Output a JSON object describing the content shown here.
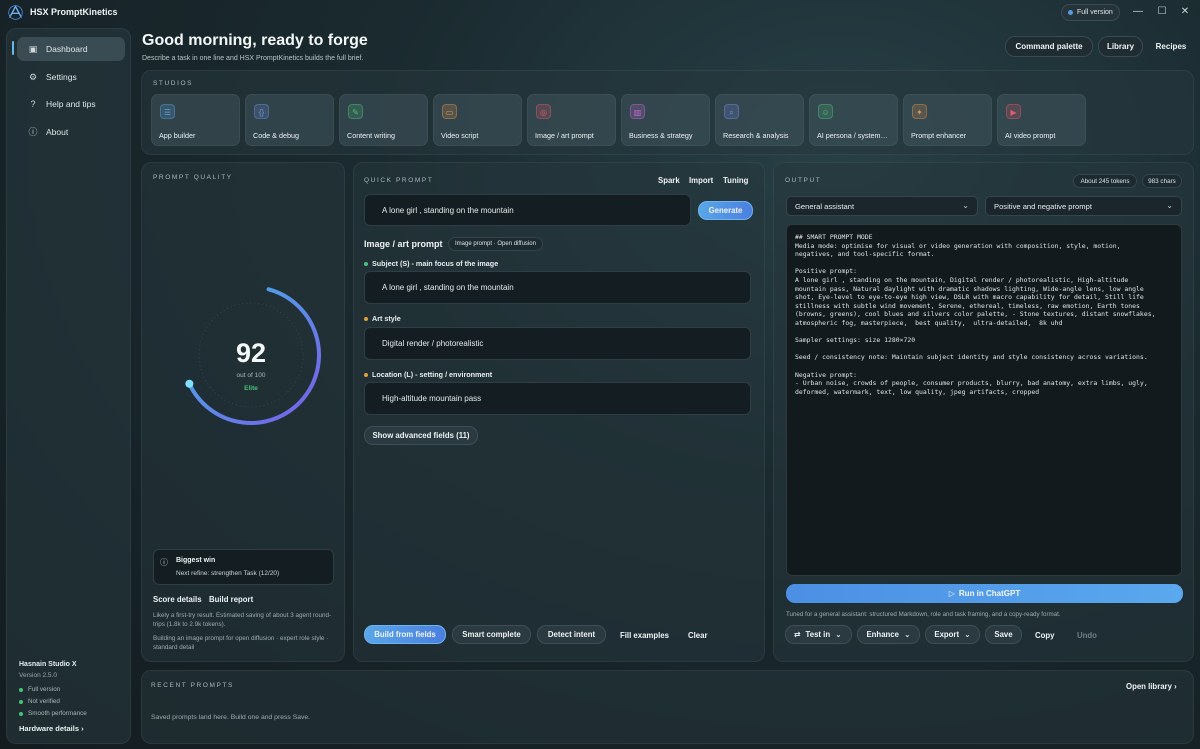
{
  "app": {
    "title": "HSX PromptKinetics",
    "badge": "Full version"
  },
  "window_controls": {
    "minimize": "—",
    "maximize": "☐",
    "close": "✕"
  },
  "sidebar": {
    "items": [
      {
        "label": "Dashboard",
        "icon": "dashboard-icon"
      },
      {
        "label": "Settings",
        "icon": "gear-icon"
      },
      {
        "label": "Help and tips",
        "icon": "question-icon"
      },
      {
        "label": "About",
        "icon": "info-icon"
      }
    ],
    "org": "Hasnain Studio X",
    "version": "Version 2.5.0",
    "status": [
      "Full version",
      "Not verified",
      "Smooth performance"
    ],
    "hardware_link": "Hardware details ›"
  },
  "header": {
    "greeting": "Good morning, ready to forge",
    "subtitle": "Describe a task in one line and HSX PromptKinetics builds the full brief.",
    "buttons": [
      "Command palette",
      "Library",
      "Recipes"
    ]
  },
  "studios": {
    "label": "STUDIOS",
    "items": [
      {
        "label": "App builder",
        "icon": "list-icon",
        "color": "#5aa6e8"
      },
      {
        "label": "Code & debug",
        "icon": "code-icon",
        "color": "#6f8fe0"
      },
      {
        "label": "Content writing",
        "icon": "pen-icon",
        "color": "#4ec27a"
      },
      {
        "label": "Video script",
        "icon": "video-icon",
        "color": "#e0944c"
      },
      {
        "label": "Image / art prompt",
        "icon": "image-icon",
        "color": "#e05a6a"
      },
      {
        "label": "Business & strategy",
        "icon": "chart-icon",
        "color": "#c86ad8"
      },
      {
        "label": "Research & analysis",
        "icon": "search-icon",
        "color": "#7a8ee8"
      },
      {
        "label": "AI persona / system…",
        "icon": "person-icon",
        "color": "#4ec27a"
      },
      {
        "label": "Prompt enhancer",
        "icon": "spark-icon",
        "color": "#e0944c"
      },
      {
        "label": "AI video prompt",
        "icon": "film-icon",
        "color": "#e05a6a"
      }
    ]
  },
  "quality": {
    "label": "PROMPT QUALITY",
    "score": "92",
    "out_of": "out of 100",
    "tier": "Elite",
    "score_value": 92,
    "win_title": "Biggest win",
    "win_detail": "Next refine: strengthen Task (12/20)",
    "score_details": "Score details",
    "build_report": "Build report",
    "note1": "Likely a first-try result. Estimated saving of about 3 agent round-trips (1.8k to 2.9k tokens).",
    "note2": "Building an image prompt for open diffusion · expert role style · standard detail"
  },
  "quick": {
    "label": "QUICK PROMPT",
    "tabs": [
      "Spark",
      "Import",
      "Tuning"
    ],
    "input": "A lone girl , standing on the mountain",
    "generate": "Generate",
    "section": "Image / art prompt",
    "section_tag": "Image prompt · Open diffusion",
    "fields": [
      {
        "label": "Subject (S) - main focus of the image",
        "value": "A lone girl , standing on the mountain",
        "color": "#49c27a"
      },
      {
        "label": "Art style",
        "value": "Digital render / photorealistic",
        "color": "#e0a040"
      },
      {
        "label": "Location (L) - setting / environment",
        "value": "High-altitude mountain pass",
        "color": "#e0a040"
      }
    ],
    "advanced": "Show advanced fields (11)",
    "actions": [
      "Build from fields",
      "Smart complete",
      "Detect intent",
      "Fill examples",
      "Clear"
    ]
  },
  "output": {
    "label": "OUTPUT",
    "tokens": "About 245 tokens",
    "chars": "983 chars",
    "select1": "General assistant",
    "select2": "Positive and negative prompt",
    "text": "## SMART PROMPT MODE\nMedia mode: optimise for visual or video generation with composition, style, motion,\nnegatives, and tool-specific format.\n\nPositive prompt:\nA lone girl , standing on the mountain, Digital render / photorealistic, High-altitude\nmountain pass, Natural daylight with dramatic shadows lighting, Wide-angle lens, low angle\nshot, Eye-level to eye-to-eye high view, DSLR with macro capability for detail, Still life\nstillness with subtle wind movement, Serene, ethereal, timeless, raw emotion, Earth tones\n(browns, greens), cool blues and silvers color palette, - Stone textures, distant snowflakes,\natmospheric fog, masterpiece,  best quality,  ultra-detailed,  8k uhd\n\nSampler settings: size 1280×720\n\nSeed / consistency note: Maintain subject identity and style consistency across variations.\n\nNegative prompt:\n- Urban noise, crowds of people, consumer products, blurry, bad anatomy, extra limbs, ugly,\ndeformed, watermark, text, low quality, jpeg artifacts, cropped",
    "run": "Run in ChatGPT",
    "tuned_note": "Tuned for a general assistant: structured Markdown, role and task framing, and a copy-ready format.",
    "actions": [
      "Test in",
      "Enhance",
      "Export",
      "Save",
      "Copy",
      "Undo"
    ]
  },
  "recent": {
    "label": "RECENT PROMPTS",
    "open_library": "Open library ›",
    "empty": "Saved prompts land here. Build one and press Save."
  }
}
